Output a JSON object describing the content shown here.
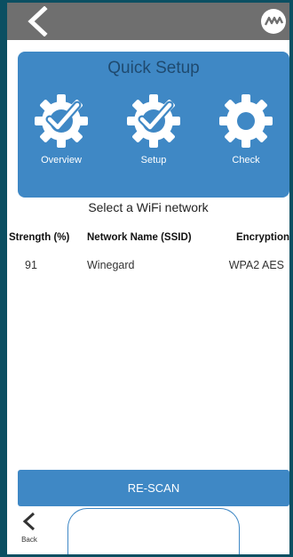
{
  "colors": {
    "frame": "#0b4f62",
    "topbar": "#6f6f6f",
    "accent_blue": "#3f88c5",
    "panel_title": "#1f4a6f",
    "white": "#ffffff"
  },
  "header": {
    "back_icon": "chevron-left-icon",
    "logo_icon": "winegard-logo-icon"
  },
  "quick_setup": {
    "title": "Quick Setup",
    "steps": [
      {
        "label": "Overview",
        "icon": "gear-check-icon"
      },
      {
        "label": "Setup",
        "icon": "gear-check-icon"
      },
      {
        "label": "Check",
        "icon": "gear-icon"
      }
    ]
  },
  "network": {
    "subtitle": "Select a WiFi network",
    "columns": [
      "Strength (%)",
      "Network Name (SSID)",
      "Encryption"
    ],
    "rows": [
      {
        "strength": "91",
        "ssid": "Winegard",
        "encryption": "WPA2 AES"
      }
    ]
  },
  "actions": {
    "rescan_label": "RE-SCAN"
  },
  "bottom_nav": {
    "back_label": "Back"
  }
}
